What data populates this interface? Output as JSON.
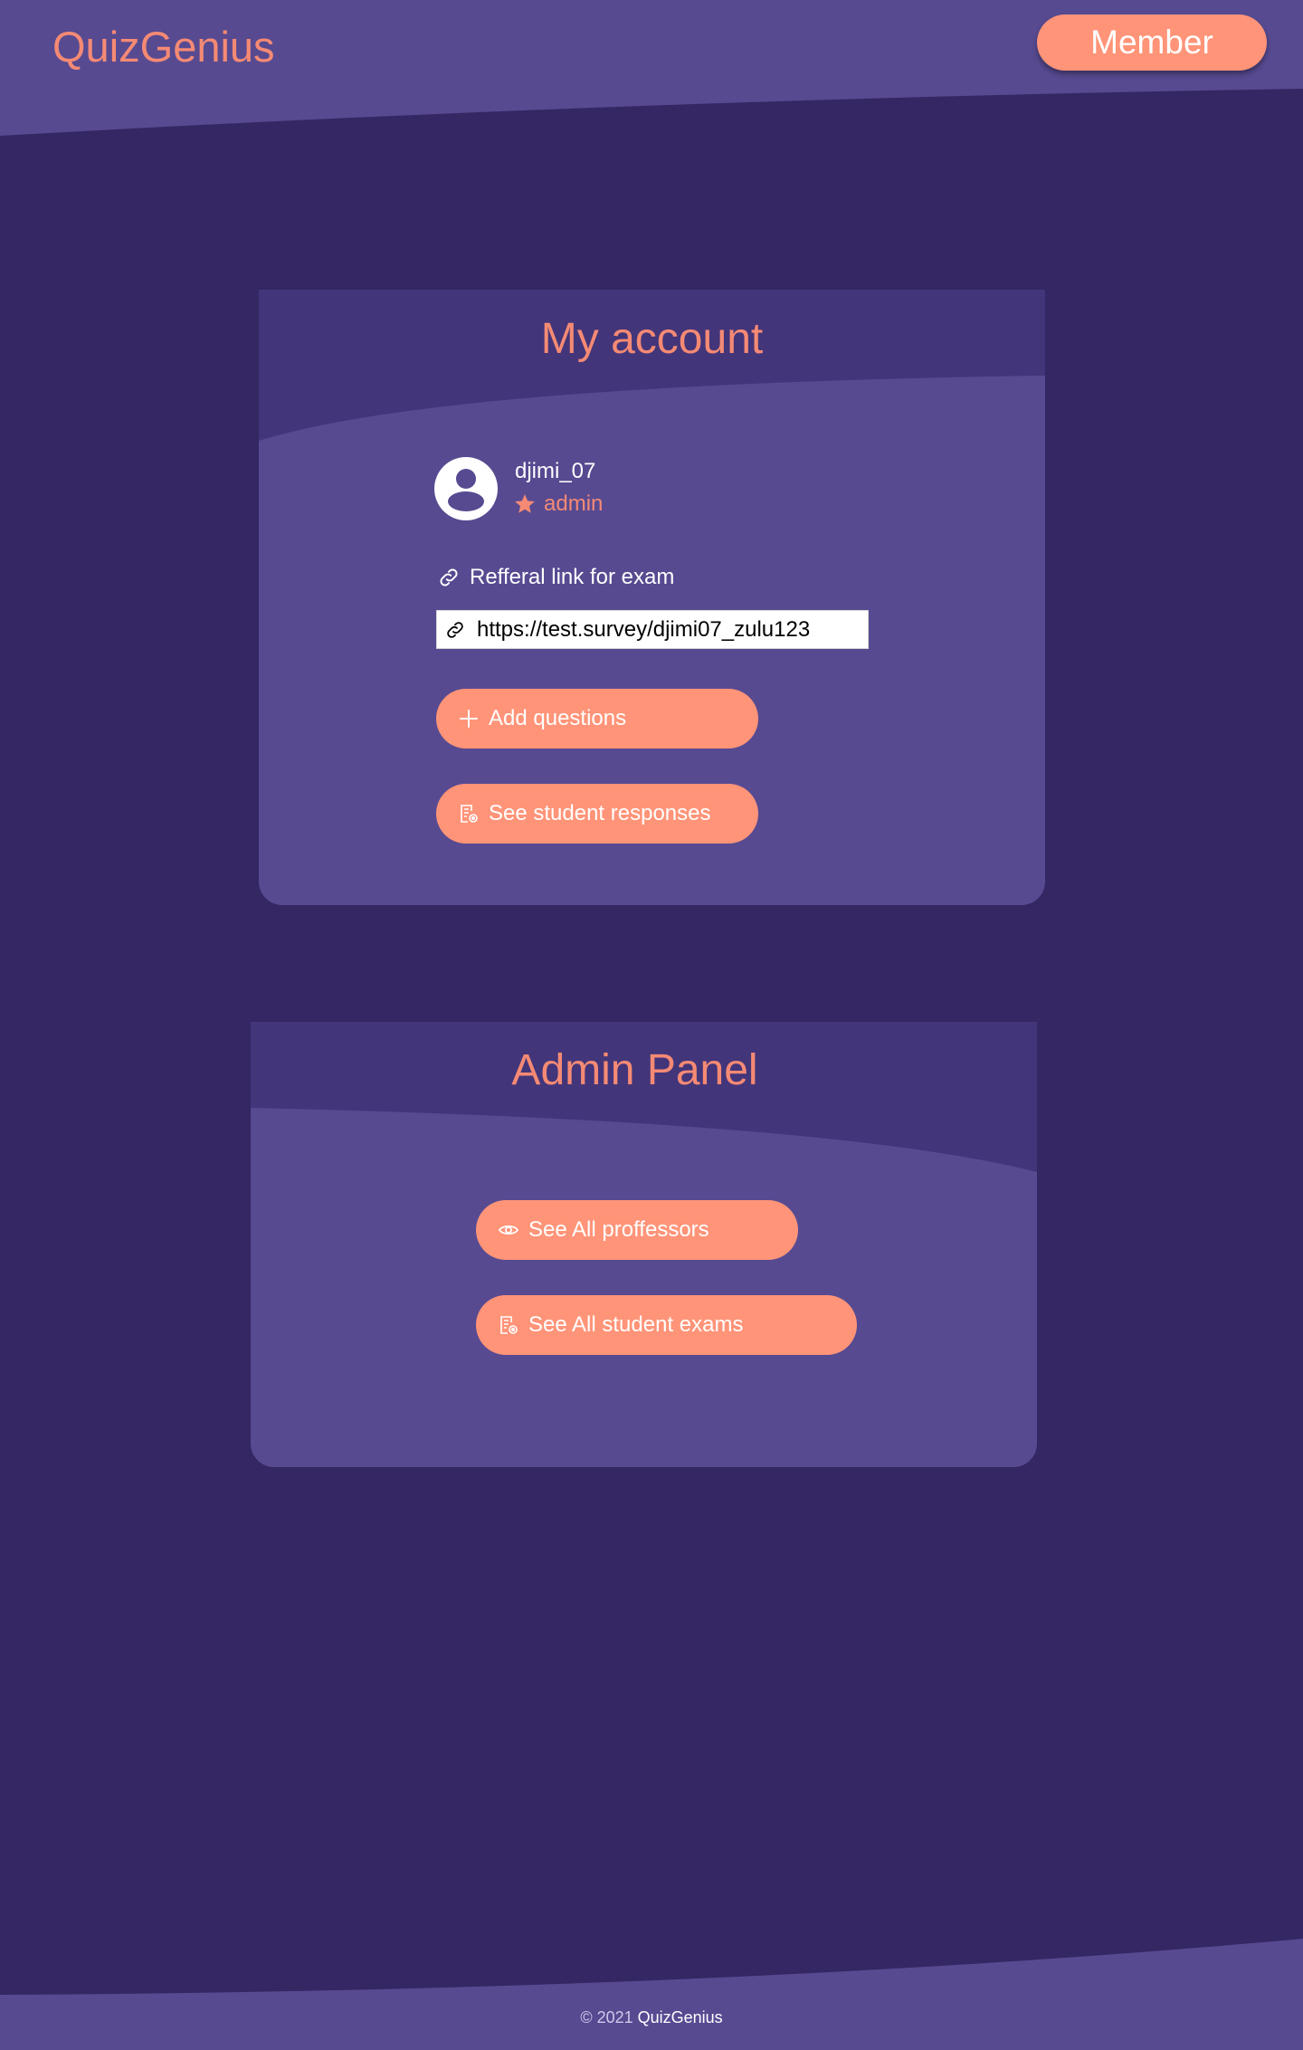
{
  "colors": {
    "page_bg": "#352763",
    "panel_bg": "#574A91",
    "panel_top": "#43357A",
    "accent": "#FF9478",
    "accent_text": "#F58A74",
    "white": "#FFFFFF"
  },
  "header": {
    "brand": "QuizGenius",
    "member_button": "Member"
  },
  "account": {
    "title": "My account",
    "username": "djimi_07",
    "role": "admin",
    "role_icon": "star-icon",
    "avatar_icon": "user-avatar-icon",
    "referral_label": "Refferal link for exam",
    "referral_icon": "link-icon",
    "referral_url": "https://test.survey/djimi07_zulu123",
    "buttons": {
      "add_questions": "Add questions",
      "add_questions_icon": "plus-icon",
      "see_responses": "See student responses",
      "see_responses_icon": "document-search-icon"
    }
  },
  "admin": {
    "title": "Admin Panel",
    "buttons": {
      "see_professors": "See All proffessors",
      "see_professors_icon": "eye-icon",
      "see_exams": "See All student exams",
      "see_exams_icon": "document-search-icon"
    }
  },
  "footer": {
    "copyright": "© 2021",
    "brand": "QuizGenius"
  }
}
